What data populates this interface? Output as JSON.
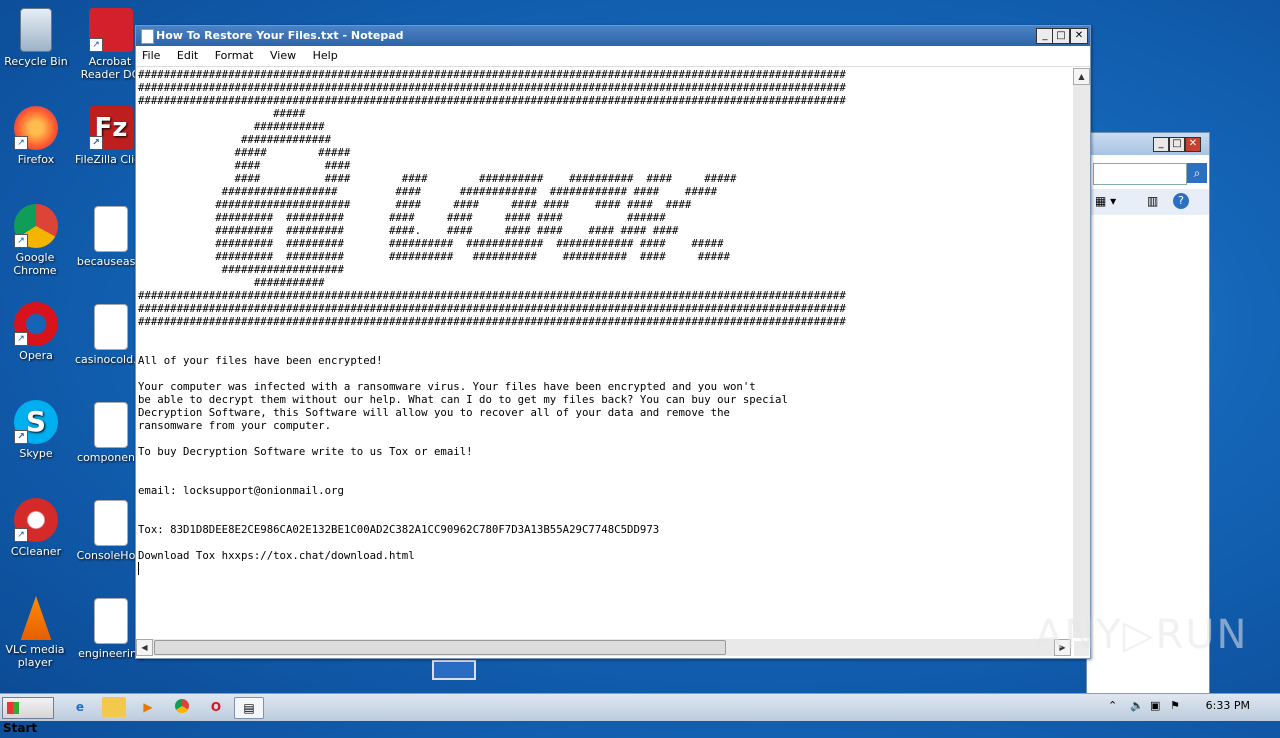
{
  "desktop": {
    "icons": [
      {
        "label": "Recycle Bin",
        "icon": "recycle-bin-icon"
      },
      {
        "label": "Acrobat Reader DC",
        "icon": "acrobat-icon"
      },
      {
        "label": "Firefox",
        "icon": "firefox-icon"
      },
      {
        "label": "FileZilla Client",
        "icon": "filezilla-icon"
      },
      {
        "label": "Google Chrome",
        "icon": "chrome-icon"
      },
      {
        "label": "becauseasia",
        "icon": "file-icon"
      },
      {
        "label": "Opera",
        "icon": "opera-icon"
      },
      {
        "label": "casinocold.rtf",
        "icon": "file-icon"
      },
      {
        "label": "Skype",
        "icon": "skype-icon"
      },
      {
        "label": "components",
        "icon": "file-icon"
      },
      {
        "label": "CCleaner",
        "icon": "ccleaner-icon"
      },
      {
        "label": "ConsoleHost",
        "icon": "file-icon"
      },
      {
        "label": "VLC media player",
        "icon": "vlc-icon"
      },
      {
        "label": "engineering",
        "icon": "file-icon"
      }
    ]
  },
  "notepad": {
    "title": "How To Restore Your Files.txt - Notepad",
    "menu": [
      "File",
      "Edit",
      "Format",
      "View",
      "Help"
    ],
    "controls": {
      "minimize": "_",
      "maximize": "□",
      "close": "✕"
    },
    "content": "##############################################################################################################\n##############################################################################################################\n##############################################################################################################\n                     #####\n                  ###########\n                ##############\n               #####        #####\n               ####          ####\n               ####          ####        ####        ##########    ##########  ####     #####\n             ##################         ####      ############  ############ ####    #####\n            #####################       ####     ####     #### ####    #### ####  ####\n            #########  #########       ####     ####     #### ####          ######\n            #########  #########       ####.    ####     #### ####    #### #### ####\n            #########  #########       ##########  ############  ############ ####    #####\n            #########  #########       ##########   ##########    ##########  ####     #####\n             ###################\n                  ###########\n##############################################################################################################\n##############################################################################################################\n##############################################################################################################\n\n\nAll of your files have been encrypted!\n\nYour computer was infected with a ransomware virus. Your files have been encrypted and you won't\nbe able to decrypt them without our help. What can I do to get my files back? You can buy our special\nDecryption Software, this Software will allow you to recover all of your data and remove the\nransomware from your computer.\n\nTo buy Decryption Software write to us Tox or email!\n\n\nemail: locksupport@onionmail.org\n\n\nTox: 83D1D8DEE8E2CE986CA02E132BE1C00AD2C382A1CC90962C780F7D3A13B55A29C7748C5DD973\n\nDownload Tox hxxps://tox.chat/download.html\n"
  },
  "taskbar": {
    "start": "Start",
    "clock": "6:33 PM",
    "pinned": [
      "ie-icon",
      "explorer-icon",
      "media-player-icon",
      "chrome-icon",
      "opera-icon",
      "notepad-icon"
    ]
  },
  "watermark": "ANY▷RUN"
}
